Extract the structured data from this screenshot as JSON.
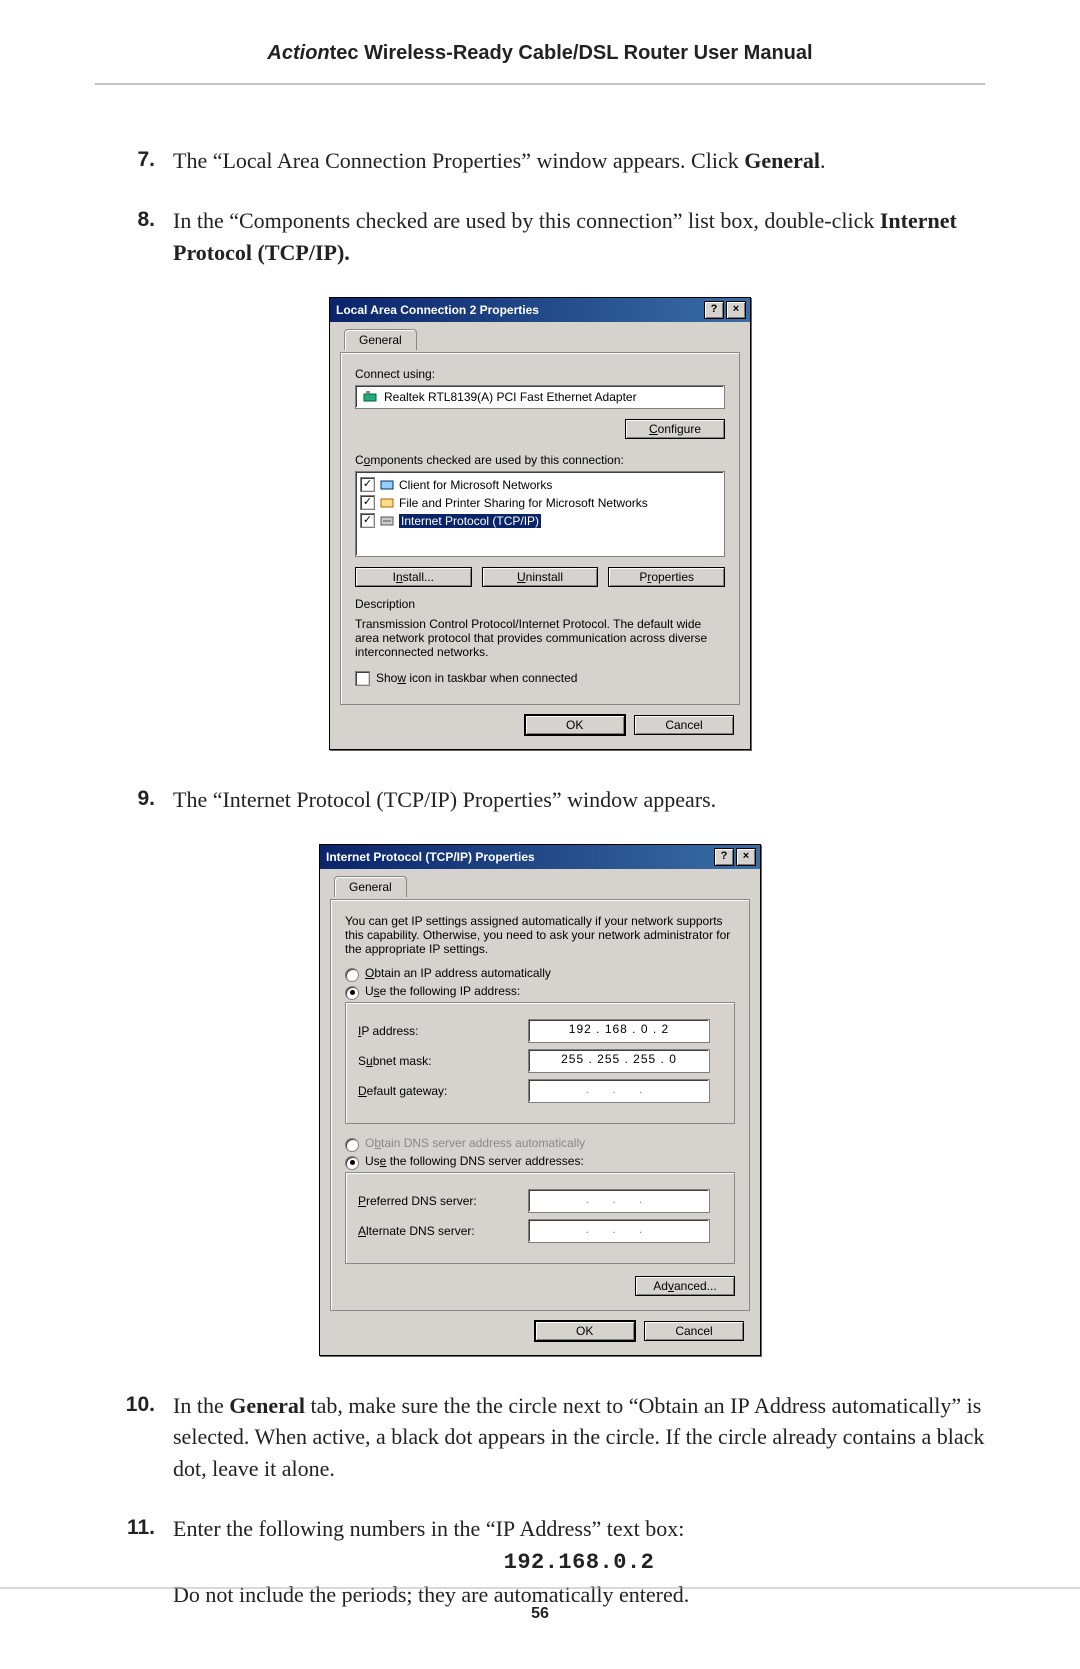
{
  "header": {
    "brand_prefix": "Action",
    "brand_suffix": "tec",
    "title_rest": " Wireless-Ready Cable/DSL Router User Manual"
  },
  "page_number": "56",
  "steps": {
    "s7": {
      "num": "7.",
      "pre": "The “Local Area Connection Properties” window appears. Click ",
      "bold": "General",
      "post": "."
    },
    "s8": {
      "num": "8.",
      "pre": "In the “Components checked are used by this connection” list box, double-click ",
      "bold1": "Internet Protocol",
      "mid": " (",
      "sc": "TCP/IP",
      "post": ")."
    },
    "s9": {
      "num": "9.",
      "pre": "The “Internet Protocol (",
      "sc": "TCP/IP",
      "post": ") Properties” window appears."
    },
    "s10": {
      "num": "10.",
      "a": "In the ",
      "bold": "General",
      "b": " tab, make sure the the circle next to “Obtain an ",
      "sc": "IP",
      "c": " Address automatically” is selected. When active, a black dot appears in the circle.  If the circle already contains a black dot, leave it alone."
    },
    "s11": {
      "num": "11.",
      "a": "Enter the following numbers in the “",
      "sc": "IP",
      "b": " Address” text box:",
      "ip": "192.168.0.2",
      "c": "Do not include the periods; they are automatically entered."
    }
  },
  "dlg1": {
    "title": "Local Area Connection 2 Properties",
    "help": "?",
    "close": "×",
    "tab_general": "General",
    "connect_using": "Connect using:",
    "adapter": "Realtek RTL8139(A) PCI Fast Ethernet Adapter",
    "configure": "Configure",
    "components_label": "Components checked are used by this connection:",
    "comp1": "Client for Microsoft Networks",
    "comp2": "File and Printer Sharing for Microsoft Networks",
    "comp3": "Internet Protocol (TCP/IP)",
    "install": "Install...",
    "uninstall": "Uninstall",
    "properties": "Properties",
    "desc_label": "Description",
    "desc_text": "Transmission Control Protocol/Internet Protocol. The default wide area network protocol that provides communication across diverse interconnected networks.",
    "show_icon": "Show icon in taskbar when connected",
    "ok": "OK",
    "cancel": "Cancel"
  },
  "dlg2": {
    "title": "Internet Protocol (TCP/IP) Properties",
    "help": "?",
    "close": "×",
    "tab_general": "General",
    "intro": "You can get IP settings assigned automatically if your network supports this capability. Otherwise, you need to ask your network administrator for the appropriate IP settings.",
    "opt_auto_ip": "Obtain an IP address automatically",
    "opt_use_ip": "Use the following IP address:",
    "ip_label": "IP address:",
    "ip_value": "192 . 168 .  0  .  2",
    "subnet_label": "Subnet mask:",
    "subnet_value": "255 . 255 . 255 .  0",
    "gateway_label": "Default gateway:",
    "gateway_value": " .     .     . ",
    "opt_auto_dns": "Obtain DNS server address automatically",
    "opt_use_dns": "Use the following DNS server addresses:",
    "pref_dns_label": "Preferred DNS server:",
    "pref_dns_value": " .     .     . ",
    "alt_dns_label": "Alternate DNS server:",
    "alt_dns_value": " .     .     . ",
    "advanced": "Advanced...",
    "ok": "OK",
    "cancel": "Cancel"
  }
}
